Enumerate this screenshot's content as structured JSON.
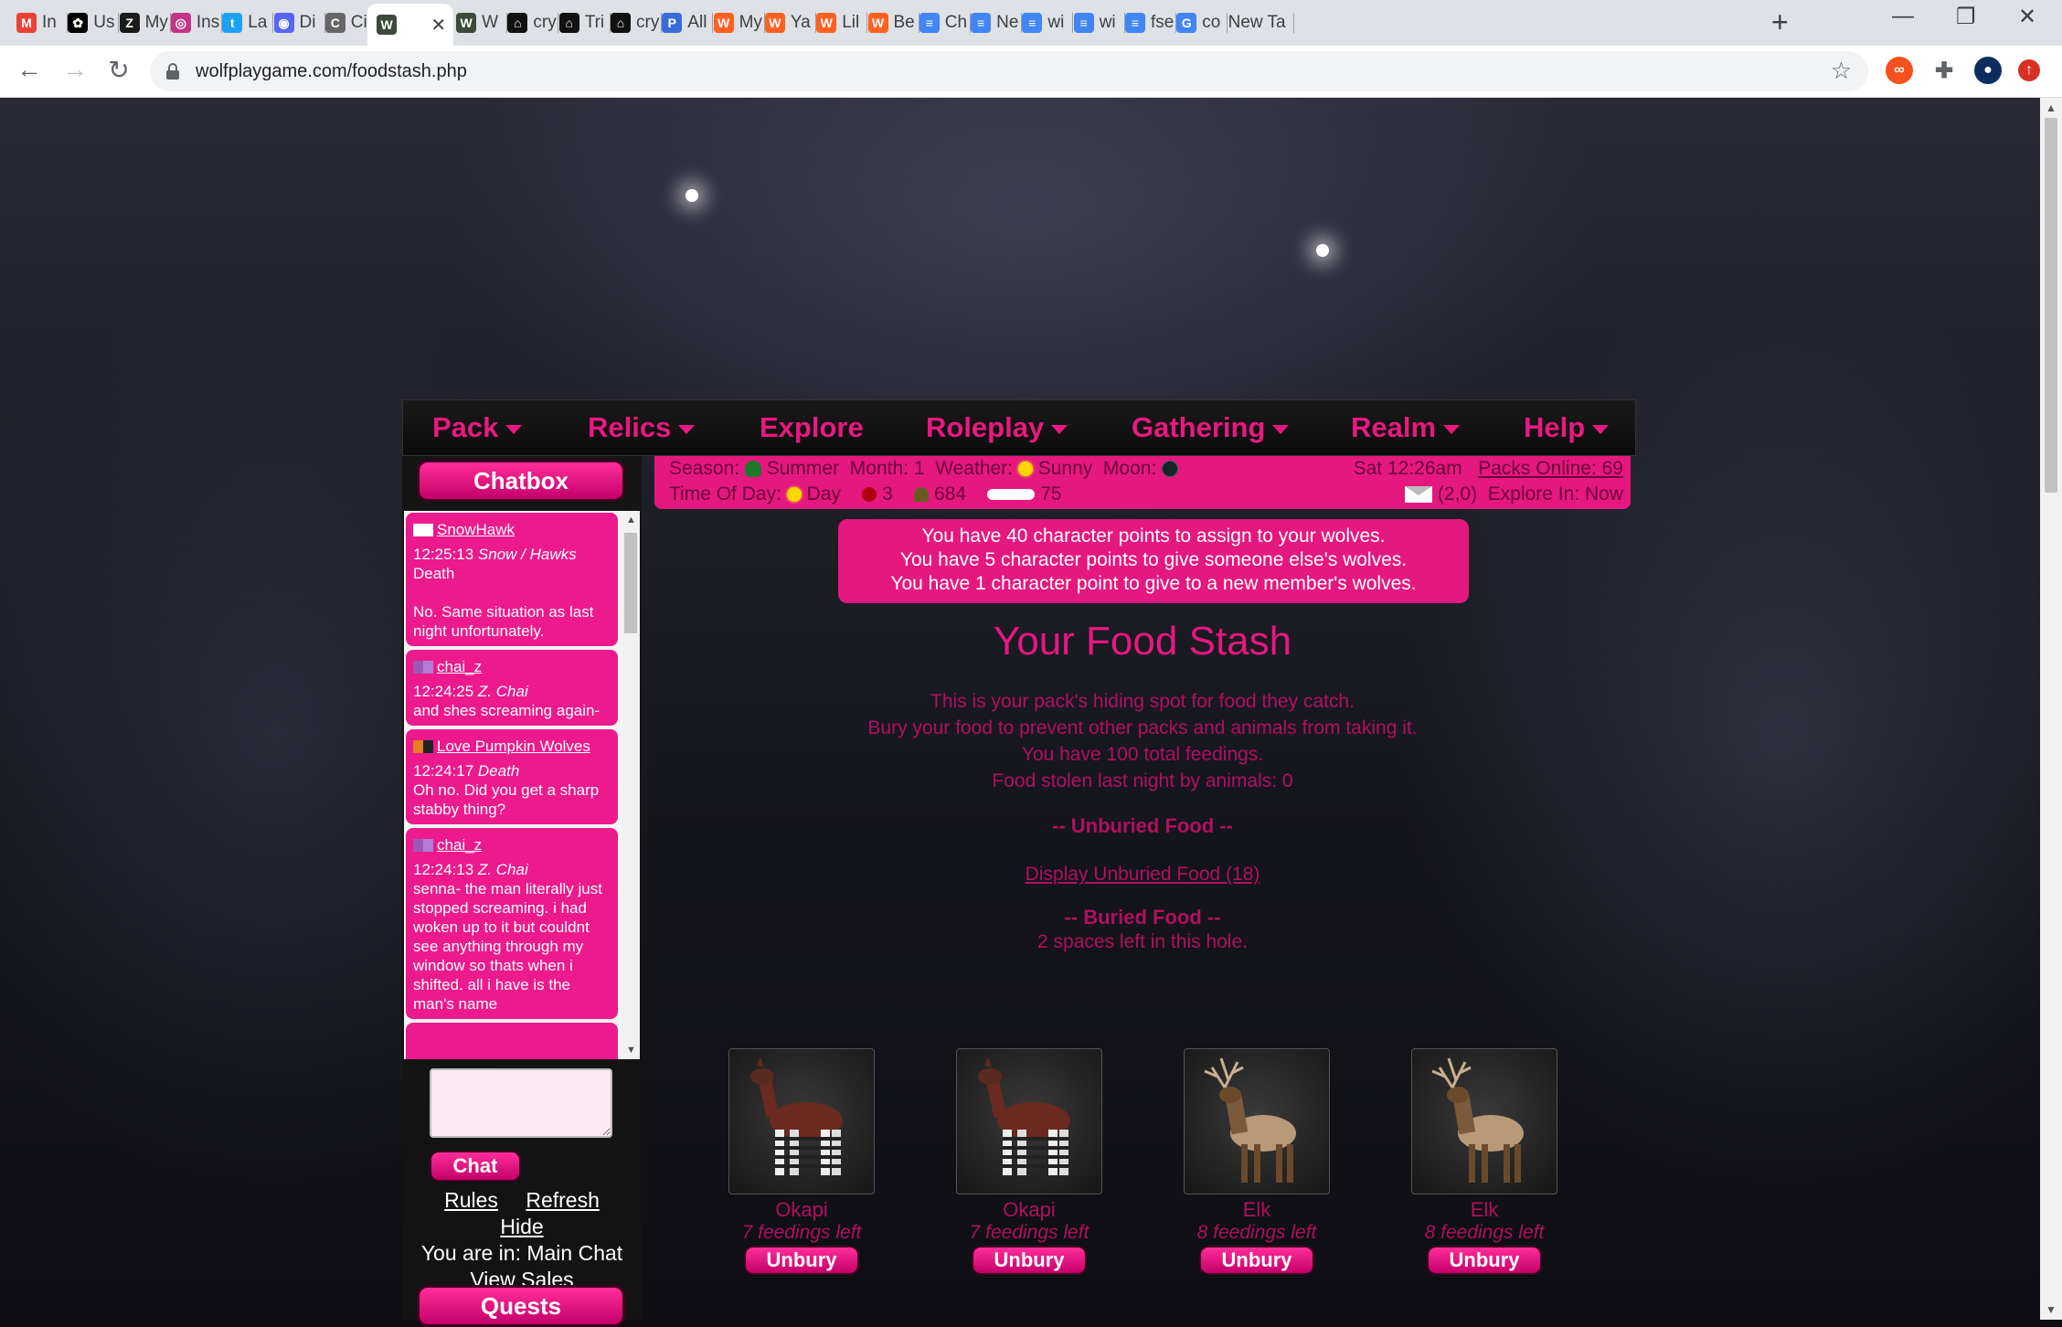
{
  "browser": {
    "tabs": [
      {
        "label": "In",
        "color": "#ea4335",
        "glyph": "M"
      },
      {
        "label": "Us",
        "color": "#000000",
        "glyph": "✿"
      },
      {
        "label": "My",
        "color": "#1a1a1a",
        "glyph": "Z"
      },
      {
        "label": "Ins",
        "color": "#c13584",
        "glyph": "◎"
      },
      {
        "label": "La",
        "color": "#1da1f2",
        "glyph": "t"
      },
      {
        "label": "Di",
        "color": "#5865f2",
        "glyph": "◉"
      },
      {
        "label": "Cir",
        "color": "#666666",
        "glyph": "C"
      },
      {
        "label": "",
        "color": "#3c4a3a",
        "glyph": "W"
      },
      {
        "label": "W",
        "color": "#3c4a3a",
        "glyph": "W"
      },
      {
        "label": "cry",
        "color": "#111111",
        "glyph": "⌂"
      },
      {
        "label": "Tri",
        "color": "#111111",
        "glyph": "⌂"
      },
      {
        "label": "cry",
        "color": "#111111",
        "glyph": "⌂"
      },
      {
        "label": "All",
        "color": "#3a6bd8",
        "glyph": "P"
      },
      {
        "label": "My",
        "color": "#ff6122",
        "glyph": "W"
      },
      {
        "label": "Ya",
        "color": "#ff6122",
        "glyph": "W"
      },
      {
        "label": "Lil",
        "color": "#ff6122",
        "glyph": "W"
      },
      {
        "label": "Be",
        "color": "#ff6122",
        "glyph": "W"
      },
      {
        "label": "Ch",
        "color": "#4285f4",
        "glyph": "≡"
      },
      {
        "label": "Ne",
        "color": "#4285f4",
        "glyph": "≡"
      },
      {
        "label": "wi",
        "color": "#4285f4",
        "glyph": "≡"
      },
      {
        "label": "wi",
        "color": "#4285f4",
        "glyph": "≡"
      },
      {
        "label": "fse",
        "color": "#4285f4",
        "glyph": "≡"
      },
      {
        "label": "co",
        "color": "#4285f4",
        "glyph": "G"
      },
      {
        "label": "New Ta",
        "color": "",
        "glyph": ""
      }
    ],
    "url": "wolfplaygame.com/foodstash.php"
  },
  "nav": {
    "items": [
      {
        "label": "Pack",
        "dropdown": true
      },
      {
        "label": "Relics",
        "dropdown": true
      },
      {
        "label": "Explore",
        "dropdown": false
      },
      {
        "label": "Roleplay",
        "dropdown": true
      },
      {
        "label": "Gathering",
        "dropdown": true
      },
      {
        "label": "Realm",
        "dropdown": true
      },
      {
        "label": "Help",
        "dropdown": true
      }
    ]
  },
  "chat": {
    "title": "Chatbox",
    "messages": [
      {
        "user": "SnowHawk",
        "flag": [
          "#ffffff",
          "#ffffff"
        ],
        "time": "12:25:13",
        "wolf": "Snow / Hawks",
        "to": "Death",
        "text": "No. Same situation as last night unfortunately."
      },
      {
        "user": "chai_z",
        "flag": [
          "#9b59b6",
          "#b07cd8"
        ],
        "time": "12:24:25",
        "wolf": "Z. Chai",
        "to": "",
        "text": "and shes screaming again-"
      },
      {
        "user": "Love Pumpkin Wolves",
        "flag": [
          "#e67e22",
          "#222222"
        ],
        "time": "12:24:17",
        "wolf": "Death",
        "to": "",
        "text": "Oh no. Did you get a sharp stabby thing?"
      },
      {
        "user": "chai_z",
        "flag": [
          "#9b59b6",
          "#b07cd8"
        ],
        "time": "12:24:13",
        "wolf": "Z. Chai",
        "to": "",
        "text": "senna- the man literally just stopped screaming. i had woken up to it but couldnt see anything through my window so thats when i shifted. all i have is the man's name"
      }
    ],
    "send_label": "Chat",
    "links": {
      "rules": "Rules",
      "refresh": "Refresh",
      "hide": "Hide"
    },
    "location": "You are in: Main Chat",
    "view_sales": "View Sales",
    "quests": "Quests"
  },
  "status": {
    "season_label": "Season:",
    "season": "Summer",
    "month_label": "Month:",
    "month": "1",
    "weather_label": "Weather:",
    "weather": "Sunny",
    "moon_label": "Moon:",
    "datetime": "Sat 12:26am",
    "packs_online": "Packs Online: 69",
    "tod_label": "Time Of Day:",
    "tod": "Day",
    "apples": "3",
    "herbs": "684",
    "bones": "75",
    "mail": "(2,0)",
    "explore": "Explore In: Now"
  },
  "points": [
    "You have 40 character points to assign to your wolves.",
    "You have 5 character points to give someone else's wolves.",
    "You have 1 character point to give to a new member's wolves."
  ],
  "stash": {
    "title": "Your Food Stash",
    "desc": [
      "This is your pack's hiding spot for food they catch.",
      "Bury your food to prevent other packs and animals from taking it.",
      "You have 100 total feedings.",
      "Food stolen last night by animals: 0"
    ],
    "unburied_heading": "-- Unburied Food --",
    "display_link": "Display Unburied Food (18)",
    "buried_heading": "-- Buried Food --",
    "spaces_left": "2 spaces left in this hole.",
    "items": [
      {
        "name": "Okapi",
        "feedings": "7 feedings left",
        "button": "Unbury",
        "animal": "okapi"
      },
      {
        "name": "Okapi",
        "feedings": "7 feedings left",
        "button": "Unbury",
        "animal": "okapi"
      },
      {
        "name": "Elk",
        "feedings": "8 feedings left",
        "button": "Unbury",
        "animal": "elk"
      },
      {
        "name": "Elk",
        "feedings": "8 feedings left",
        "button": "Unbury",
        "animal": "elk"
      }
    ]
  }
}
